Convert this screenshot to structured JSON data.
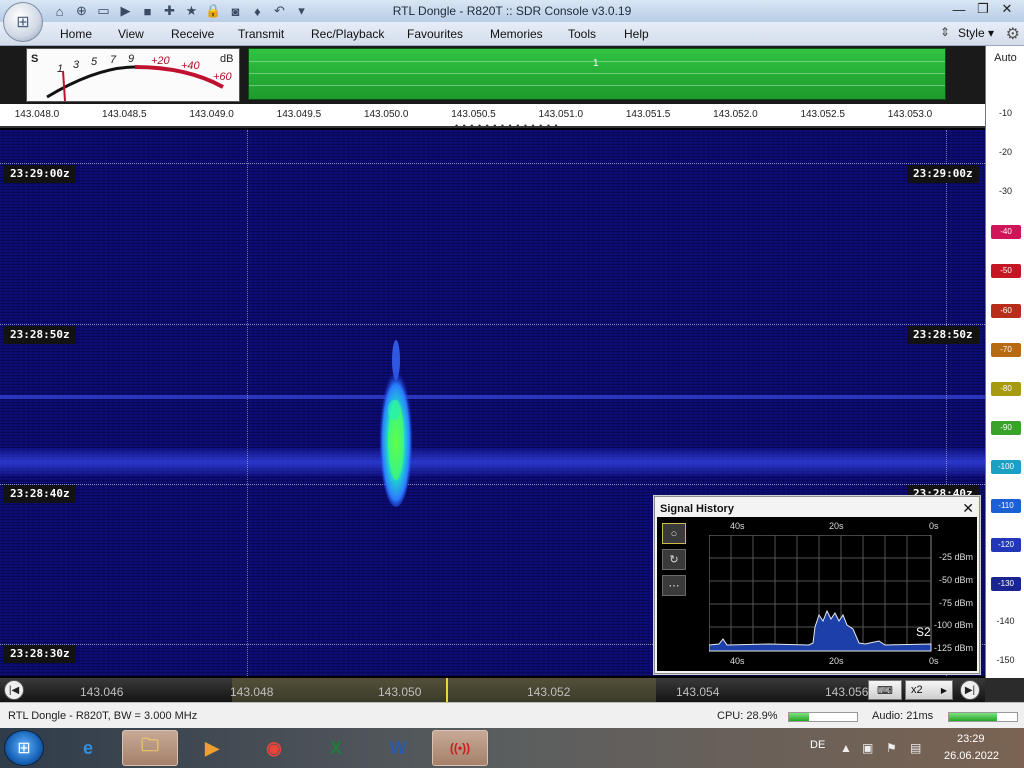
{
  "window": {
    "title": "RTL Dongle - R820T :: SDR Console v3.0.19",
    "minimize": "—",
    "maximize": "❐",
    "close": "✕"
  },
  "quick_access": [
    "home-icon",
    "lifebuoy-icon",
    "folder-icon",
    "play-icon",
    "stop-icon",
    "plus-icon",
    "star-icon",
    "lock-icon",
    "camera-icon",
    "drop-icon",
    "undo-icon",
    "dropdown-icon"
  ],
  "menu": {
    "items": [
      "Home",
      "View",
      "Receive",
      "Transmit",
      "Rec/Playback",
      "Favourites",
      "Memories",
      "Tools",
      "Help"
    ],
    "style_label": "Style"
  },
  "smeter": {
    "s_label": "S",
    "db_label": "dB",
    "scale_white": [
      "1",
      "3",
      "5",
      "7",
      "9"
    ],
    "scale_red": [
      "+20",
      "+40",
      "+60"
    ]
  },
  "overview": {
    "marker_label": "1"
  },
  "freq_scale": {
    "ticks": [
      "143.048.0",
      "143.048.5",
      "143.049.0",
      "143.049.5",
      "143.050.0",
      "143.050.5",
      "143.051.0",
      "143.051.5",
      "143.052.0",
      "143.052.5",
      "143.053.0"
    ],
    "dots": "• • • • • • • • • • • • • •"
  },
  "db_scale": {
    "auto_label": "Auto",
    "ticks": [
      "-10",
      "-20",
      "-30",
      "-40",
      "-50",
      "-60",
      "-70",
      "-80",
      "-90",
      "-100",
      "-110",
      "-120",
      "-130",
      "-140",
      "-150"
    ],
    "tick_colors": [
      "",
      "",
      "",
      "#d0145a",
      "#c41623",
      "#b72d1a",
      "#b66a12",
      "#a69a10",
      "#3aa12a",
      "#1ba0c4",
      "#1c5fd6",
      "#2137b8",
      "#1b2590",
      "",
      ""
    ]
  },
  "waterfall": {
    "time_labels": [
      "23:29:00z",
      "23:28:50z",
      "23:28:40z",
      "23:28:30z"
    ],
    "time_labels_right": [
      "23:29:00z",
      "23:28:50z",
      "23:28:40z"
    ]
  },
  "signal_history": {
    "title": "Signal History",
    "close": "✕",
    "top_labels": [
      "40s",
      "20s",
      "0s"
    ],
    "bottom_labels": [
      "40s",
      "20s",
      "0s"
    ],
    "dbm_labels": [
      "-25 dBm",
      "-50 dBm",
      "-75 dBm",
      "-100 dBm",
      "-125 dBm"
    ],
    "s_reading": "S2",
    "side_buttons": [
      "○",
      "↻",
      "⋯"
    ]
  },
  "tuning_strip": {
    "ticks": [
      "143.046",
      "143.048",
      "143.050",
      "143.052",
      "143.054",
      "143.056"
    ],
    "x2_label": "x2",
    "arrow_right": "▶",
    "left_round": "|◀",
    "right_round": "▶|",
    "keyboard": "⌨"
  },
  "status": {
    "left": "RTL Dongle - R820T, BW = 3.000 MHz",
    "cpu": "CPU: 28.9%",
    "cpu_value": 0.289,
    "audio": "Audio: 21ms",
    "audio_value": 0.7
  },
  "taskbar": {
    "apps": [
      {
        "glyph": "e",
        "color": "#2f8fe0"
      },
      {
        "glyph": "🗀",
        "color": "#f1c96b"
      },
      {
        "glyph": "▶",
        "color": "#f0a030"
      },
      {
        "glyph": "◉",
        "color": "#e6463a"
      },
      {
        "glyph": "X",
        "color": "#1e7b3c"
      },
      {
        "glyph": "W",
        "color": "#2b5aa8"
      },
      {
        "glyph": "((•))",
        "color": "#c81e1e"
      }
    ],
    "language": "DE",
    "time": "23:29",
    "date": "26.06.2022"
  }
}
